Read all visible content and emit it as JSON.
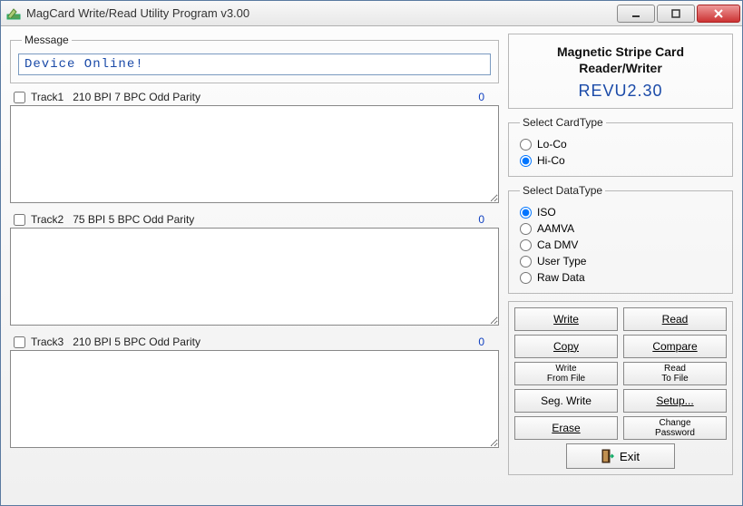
{
  "window": {
    "title": "MagCard Write/Read Utility Program v3.00"
  },
  "message": {
    "legend": "Message",
    "value": "Device Online!"
  },
  "tracks": [
    {
      "checked": false,
      "name": "Track1",
      "spec": "210 BPI  7 BPC  Odd Parity",
      "count": "0"
    },
    {
      "checked": false,
      "name": "Track2",
      "spec": "75 BPI  5 BPC  Odd Parity",
      "count": "0"
    },
    {
      "checked": false,
      "name": "Track3",
      "spec": "210 BPI  5 BPC  Odd Parity",
      "count": "0"
    }
  ],
  "info": {
    "title_line1": "Magnetic Stripe Card",
    "title_line2": "Reader/Writer",
    "rev": "REVU2.30"
  },
  "cardtype": {
    "legend": "Select CardType",
    "options": [
      "Lo-Co",
      "Hi-Co"
    ],
    "selected": "Hi-Co"
  },
  "datatype": {
    "legend": "Select DataType",
    "options": [
      "ISO",
      "AAMVA",
      "Ca DMV",
      "User Type",
      "Raw Data"
    ],
    "selected": "ISO"
  },
  "buttons": {
    "write": "Write",
    "read": "Read",
    "copy": "Copy",
    "compare": "Compare",
    "write_from_file": "Write\nFrom File",
    "read_to_file": "Read\nTo File",
    "seg_write": "Seg. Write",
    "setup": "Setup...",
    "erase": "Erase",
    "change_password": "Change\nPassword",
    "exit": "Exit"
  }
}
